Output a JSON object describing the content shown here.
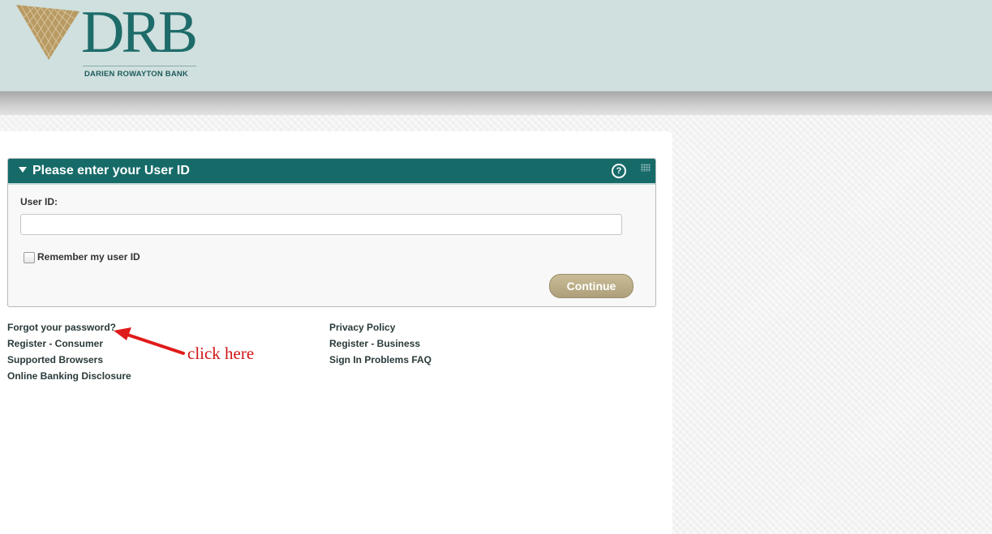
{
  "brand": {
    "logo_text": "DRB",
    "bank_name": "DARIEN ROWAYTON BANK",
    "colors": {
      "teal": "#166b69",
      "gold": "#b89a63",
      "header_bg": "#cfe0df"
    }
  },
  "login_panel": {
    "title": "Please enter your User ID",
    "help_icon": "?",
    "user_id_label": "User ID:",
    "user_id_value": "",
    "user_id_placeholder": "",
    "remember_label": "Remember my user ID",
    "remember_checked": false,
    "continue_label": "Continue"
  },
  "links_left": [
    "Forgot your password?",
    "Register - Consumer",
    "Supported Browsers",
    "Online Banking Disclosure"
  ],
  "links_right": [
    "Privacy Policy",
    "Register - Business",
    "Sign In Problems FAQ"
  ],
  "annotation": {
    "text": "click here",
    "color": "#d01515"
  }
}
